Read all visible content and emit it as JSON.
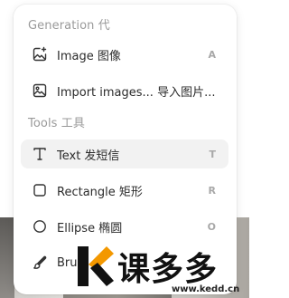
{
  "generation": {
    "title": "Generation 代",
    "items": [
      {
        "label": "Image 图像",
        "shortcut": "A",
        "icon": "image-sparkle-icon"
      },
      {
        "label": "Import images... 导入图片...",
        "shortcut": "",
        "icon": "import-image-icon"
      }
    ]
  },
  "tools": {
    "title": "Tools 工具",
    "items": [
      {
        "label": "Text 发短信",
        "shortcut": "T",
        "icon": "text-icon",
        "active": true
      },
      {
        "label": "Rectangle 矩形",
        "shortcut": "R",
        "icon": "rectangle-icon"
      },
      {
        "label": "Ellipse 椭圆",
        "shortcut": "O",
        "icon": "ellipse-icon"
      },
      {
        "label": "Bru",
        "shortcut": "",
        "icon": "brush-icon"
      }
    ]
  },
  "watermark": {
    "text": "课多多",
    "url": "www.kedd.cn"
  },
  "colors": {
    "accent_orange": "#f39800",
    "active_row": "#f2f2f2"
  }
}
